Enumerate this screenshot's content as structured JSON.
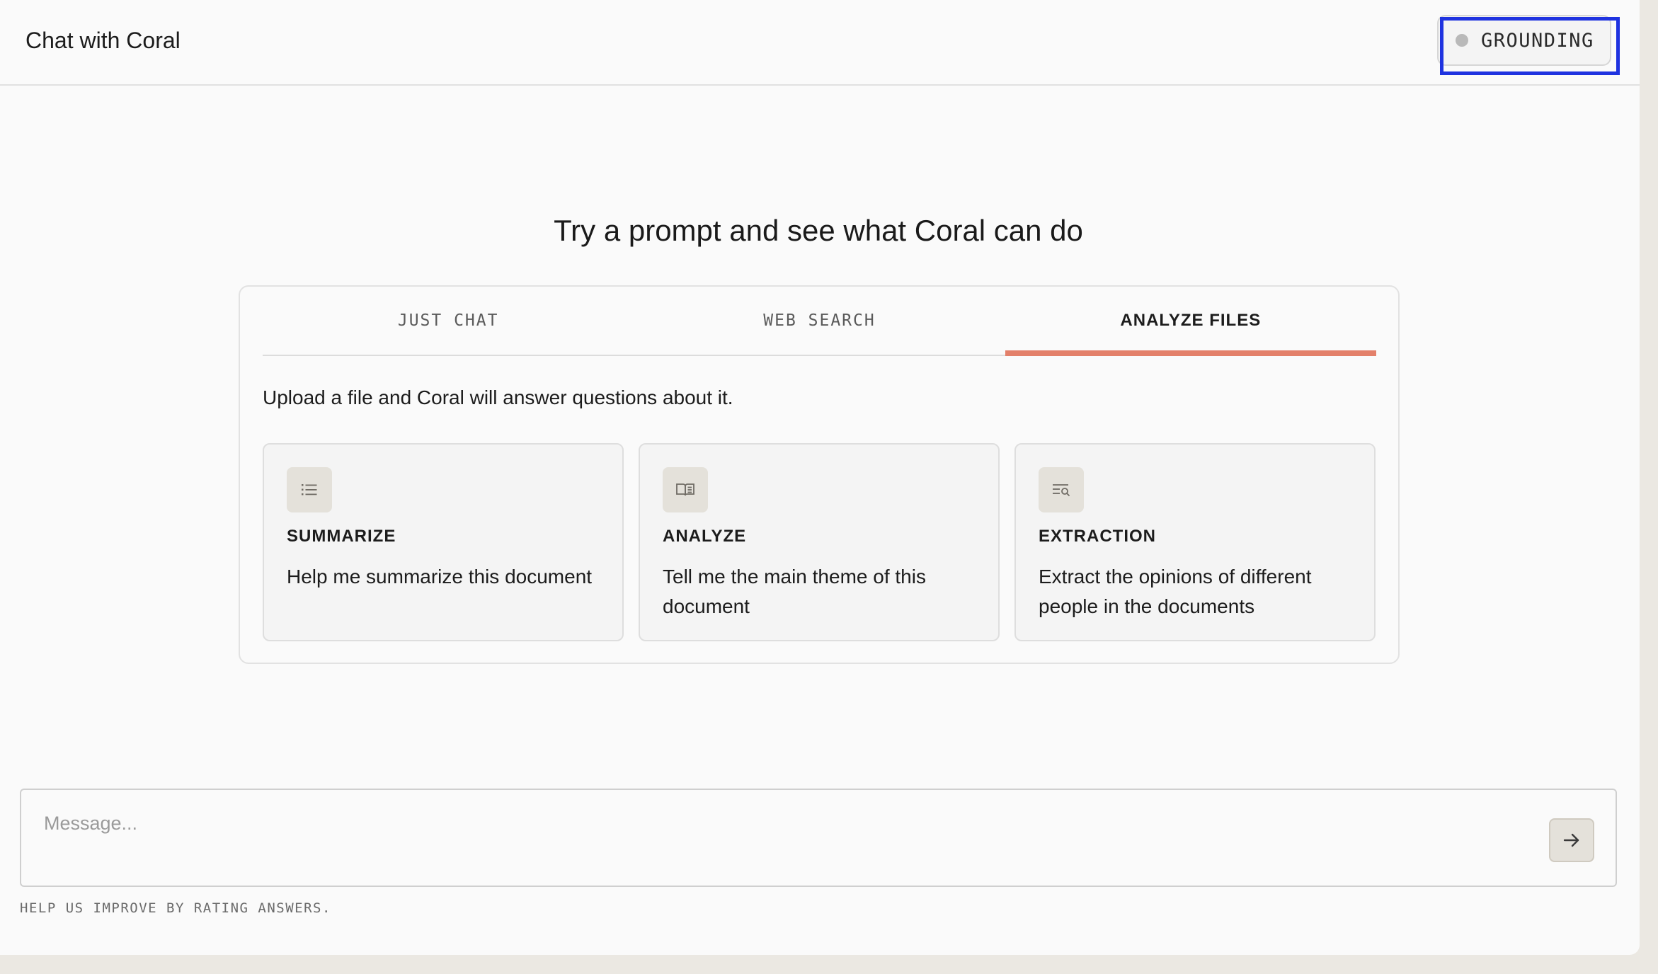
{
  "header": {
    "title": "Chat with Coral",
    "grounding": {
      "label": "GROUNDING",
      "status_color": "#b9b9b9"
    }
  },
  "main": {
    "heading": "Try a prompt and see what Coral can do",
    "tabs": [
      {
        "label": "JUST CHAT",
        "active": false
      },
      {
        "label": "WEB SEARCH",
        "active": false
      },
      {
        "label": "ANALYZE FILES",
        "active": true
      }
    ],
    "description": "Upload a file and Coral will answer questions about it.",
    "cards": [
      {
        "icon": "list-icon",
        "title": "SUMMARIZE",
        "text": "Help me summarize this document"
      },
      {
        "icon": "book-icon",
        "title": "ANALYZE",
        "text": "Tell me the main theme of this document"
      },
      {
        "icon": "search-list-icon",
        "title": "EXTRACTION",
        "text": "Extract the opinions of different people in the documents"
      }
    ]
  },
  "composer": {
    "placeholder": "Message...",
    "value": "",
    "send_icon": "arrow-right-icon"
  },
  "footer": {
    "note": "HELP US IMPROVE BY RATING ANSWERS."
  },
  "colors": {
    "accent": "#e3806a",
    "highlight": "#1f33e0",
    "background": "#fafafa"
  }
}
